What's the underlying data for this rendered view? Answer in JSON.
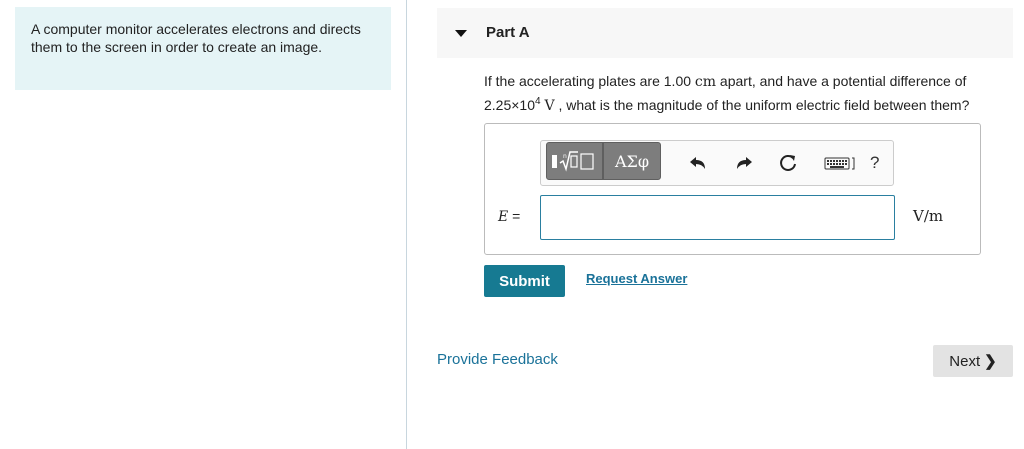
{
  "intro": {
    "text": "A computer monitor accelerates electrons and directs them to the screen in order to create an image."
  },
  "part": {
    "title": "Part A"
  },
  "question": {
    "pre": "If the accelerating plates are 1.00 ",
    "unit1": "cm",
    "mid": " apart, and have a potential difference of ",
    "coef": "2.25×10",
    "exp": "4",
    "unit2": "V",
    "post": " , what is the magnitude of the uniform electric field between them?"
  },
  "toolbar": {
    "greek_label": "ΑΣφ",
    "help_label": "?",
    "icons": [
      "templates-icon",
      "greek-symbols-icon",
      "undo-icon",
      "redo-icon",
      "reset-icon",
      "keyboard-icon",
      "help-icon"
    ]
  },
  "answer": {
    "variable": "E",
    "equals": " =",
    "value": "",
    "unit": "V/m"
  },
  "actions": {
    "submit_label": "Submit",
    "request_answer_label": "Request Answer"
  },
  "footer": {
    "feedback_label": "Provide Feedback",
    "next_label": "Next"
  },
  "colors": {
    "intro_bg": "#e5f4f6",
    "submit_bg": "#167a92",
    "link": "#1a7299",
    "input_border": "#2a7fa0",
    "toolbar_btn": "#7d7d7d"
  }
}
